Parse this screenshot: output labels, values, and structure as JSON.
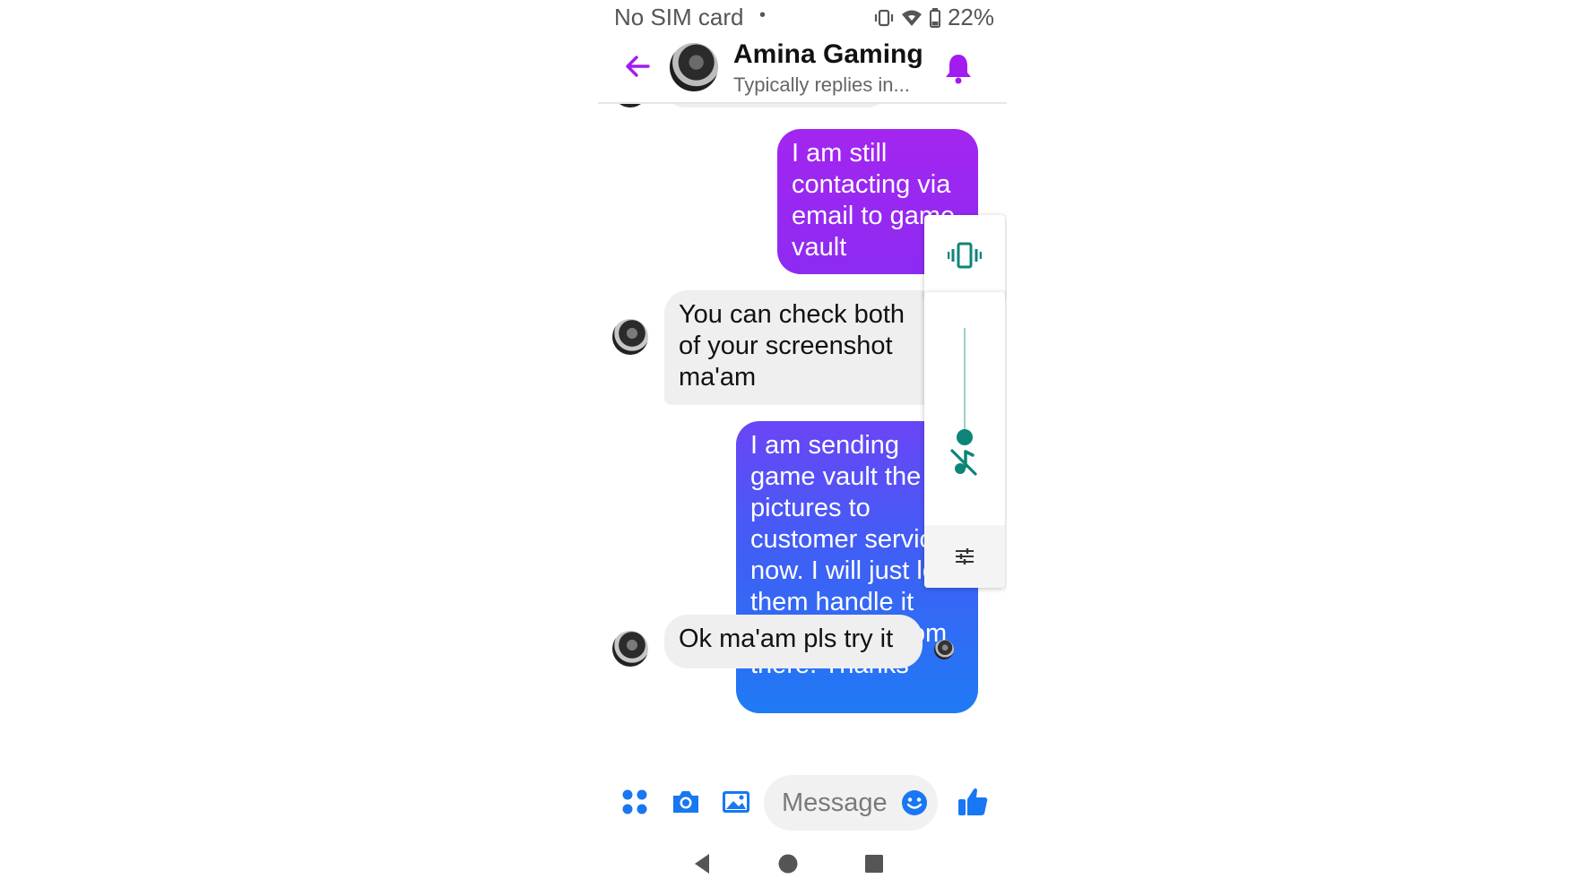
{
  "status_bar": {
    "carrier": "No SIM card",
    "separator": "•",
    "battery": "22%",
    "icons": [
      "vibrate-icon",
      "wifi-icon",
      "battery-icon"
    ]
  },
  "header": {
    "title": "Amina Gaming",
    "subtitle": "Typically replies in...",
    "accent_color": "#a21cf0",
    "icons": [
      "back-arrow-icon",
      "bell-icon"
    ]
  },
  "messages": [
    {
      "direction": "outgoing",
      "text": "I am still contacting via email to game vault",
      "color": "#9a27f1"
    },
    {
      "direction": "incoming",
      "text": "You can check both of your screenshot ma'am"
    },
    {
      "direction": "outgoing",
      "text": "I am sending game vault the pictures to customer service now. I will just let them handle it and I will go from there. Thanks",
      "color": "#2f6ff5"
    },
    {
      "direction": "incoming",
      "text": "Ok ma'am pls try it"
    }
  ],
  "volume_panel": {
    "accent_color": "#0f8478",
    "icons": [
      "vibrate-mode-icon",
      "mute-music-icon",
      "equalizer-settings-icon"
    ],
    "level": 0.0
  },
  "composer": {
    "placeholder": "Message",
    "accent_color": "#1877f2",
    "icons": [
      "apps-grid-icon",
      "camera-icon",
      "gallery-icon",
      "emoji-icon",
      "thumbs-up-icon"
    ]
  },
  "nav_bar": {
    "icons": [
      "back-triangle-icon",
      "home-circle-icon",
      "recents-square-icon"
    ]
  }
}
